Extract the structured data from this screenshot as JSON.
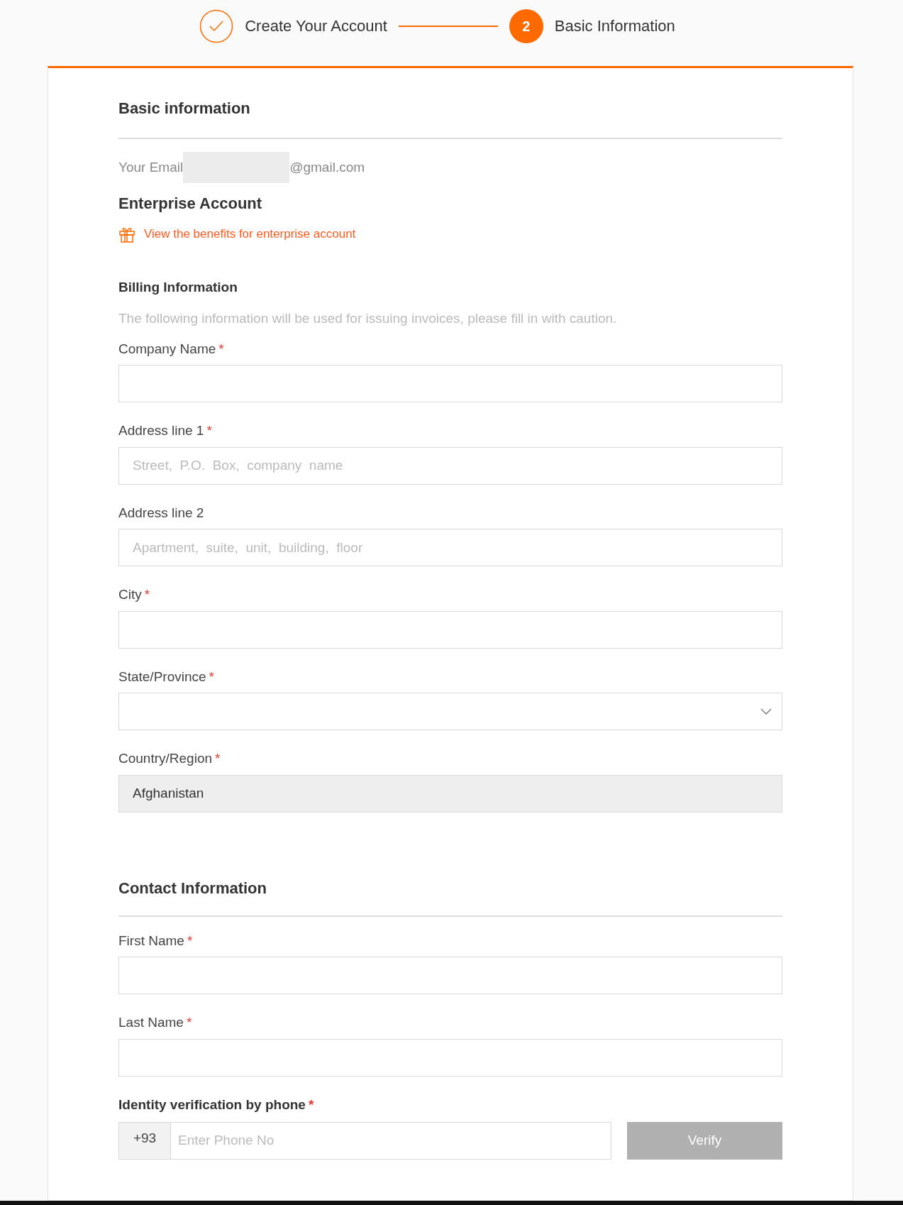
{
  "steps": [
    {
      "label": "Create Your Account",
      "completed": true
    },
    {
      "label": "Basic Information",
      "completed": false,
      "number": "2"
    }
  ],
  "basic": {
    "title": "Basic information",
    "email_label": "Your Email",
    "email_value": "@gmail.com"
  },
  "enterprise": {
    "title": "Enterprise Account",
    "link": "View the benefits for enterprise account"
  },
  "billing": {
    "title": "Billing Information",
    "note": "The following information will be used for issuing invoices, please fill in with caution.",
    "fields": [
      {
        "kind": "text",
        "label": "Company Name",
        "required_mark": "*"
      },
      {
        "kind": "text",
        "label": "Address line 1",
        "required_mark": "*",
        "placeholder": "Street,  P.O.  Box,  company  name"
      },
      {
        "kind": "text",
        "label": "Address line 2",
        "placeholder": "Apartment,  suite,  unit,  building,  floor"
      },
      {
        "kind": "text",
        "label": "City",
        "required_mark": "*"
      },
      {
        "kind": "select",
        "label": "State/Province",
        "required_mark": "*"
      },
      {
        "kind": "readonly",
        "label": "Country/Region",
        "required_mark": "*",
        "value": "Afghanistan"
      }
    ]
  },
  "contact": {
    "title": "Contact Information",
    "fields": [
      {
        "kind": "text",
        "label": "First Name",
        "required_mark": "*"
      },
      {
        "kind": "text",
        "label": "Last Name",
        "required_mark": "*"
      }
    ],
    "phone": {
      "label": "Identity verification by phone",
      "required_mark": "*",
      "prefix": "+93",
      "placeholder": "Enter Phone No",
      "button": "Verify",
      "button_disabled": true
    }
  }
}
